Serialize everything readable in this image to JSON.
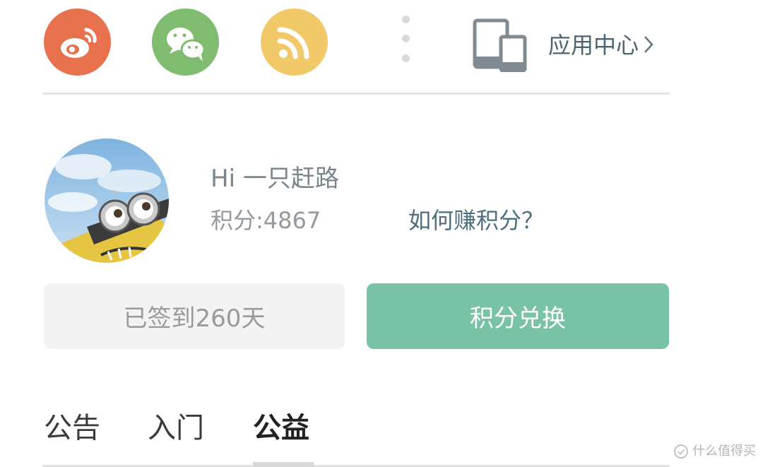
{
  "share": {
    "items": [
      {
        "name": "weibo",
        "color": "#e8714e",
        "icon": "weibo-icon"
      },
      {
        "name": "wechat",
        "color": "#80bc70",
        "icon": "wechat-icon"
      },
      {
        "name": "rss",
        "color": "#f1c968",
        "icon": "rss-icon"
      }
    ]
  },
  "app_center": {
    "label": "应用中心",
    "icon": "mobile-devices-icon",
    "chevron": "chevron-right-icon"
  },
  "user": {
    "greeting": "Hi 一只赶路",
    "points_text": "积分:4867",
    "how_to_earn": "如何赚积分？",
    "avatar": "minion-avatar"
  },
  "buttons": {
    "signed_in": "已签到260天",
    "exchange": "积分兑换",
    "exchange_color": "#78c2a6"
  },
  "tabs": [
    {
      "label": "公告",
      "active": false
    },
    {
      "label": "入门",
      "active": false
    },
    {
      "label": "公益",
      "active": true
    }
  ],
  "watermark": {
    "text": "什么值得买"
  }
}
